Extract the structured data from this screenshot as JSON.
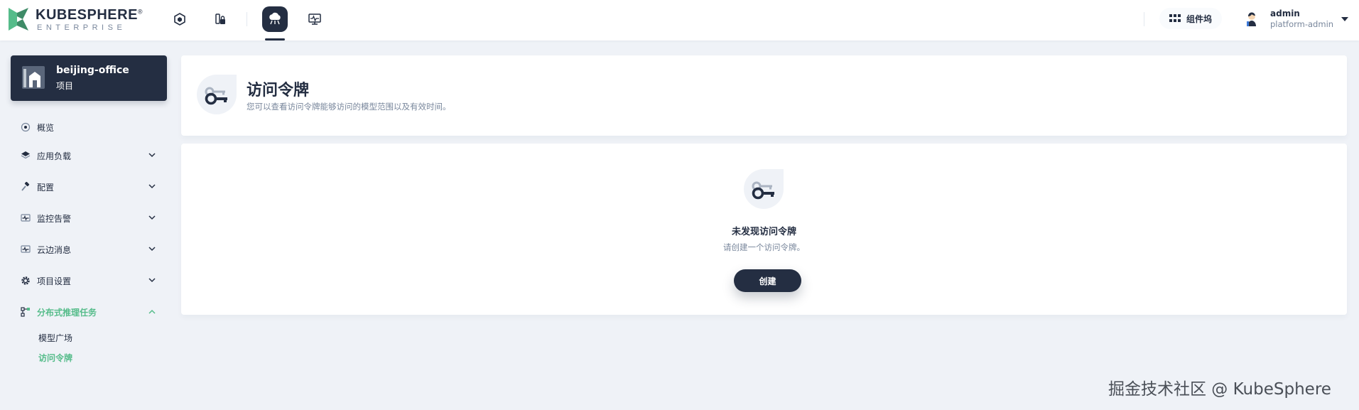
{
  "brand": {
    "name": "KUBESPHERE",
    "registered": "®",
    "sub": "ENTERPRISE"
  },
  "topnav": {
    "icons": [
      "workspace-icon",
      "cluster-lock-icon",
      "cloud-edge-icon",
      "monitor-icon"
    ],
    "active_index": 2,
    "components_label": "组件坞",
    "user": {
      "name": "admin",
      "role": "platform-admin"
    }
  },
  "project": {
    "name": "beijing-office",
    "type": "项目"
  },
  "sidebar": {
    "items": [
      {
        "label": "概览",
        "icon": "overview-icon",
        "has_children": false
      },
      {
        "label": "应用负载",
        "icon": "layers-icon",
        "has_children": true
      },
      {
        "label": "配置",
        "icon": "hammer-icon",
        "has_children": true
      },
      {
        "label": "监控告警",
        "icon": "monitor-icon",
        "has_children": true
      },
      {
        "label": "云边消息",
        "icon": "monitor-icon",
        "has_children": true
      },
      {
        "label": "项目设置",
        "icon": "gear-icon",
        "has_children": true
      },
      {
        "label": "分布式推理任务",
        "icon": "network-icon",
        "has_children": true,
        "expanded": true
      }
    ],
    "subitems": [
      {
        "label": "模型广场",
        "active": false
      },
      {
        "label": "访问令牌",
        "active": true
      }
    ],
    "accent_color": "#55bc8a"
  },
  "page": {
    "title": "访问令牌",
    "description": "您可以查看访问令牌能够访问的模型范围以及有效时间。",
    "icon": "key-icon"
  },
  "empty_state": {
    "title": "未发现访问令牌",
    "description": "请创建一个访问令牌。",
    "button_label": "创建",
    "icon": "key-icon"
  },
  "watermark": "掘金技术社区 @ KubeSphere",
  "colors": {
    "primary": "#242e42",
    "accent": "#55bc8a",
    "background": "#eff2f7",
    "muted": "#79879c"
  }
}
